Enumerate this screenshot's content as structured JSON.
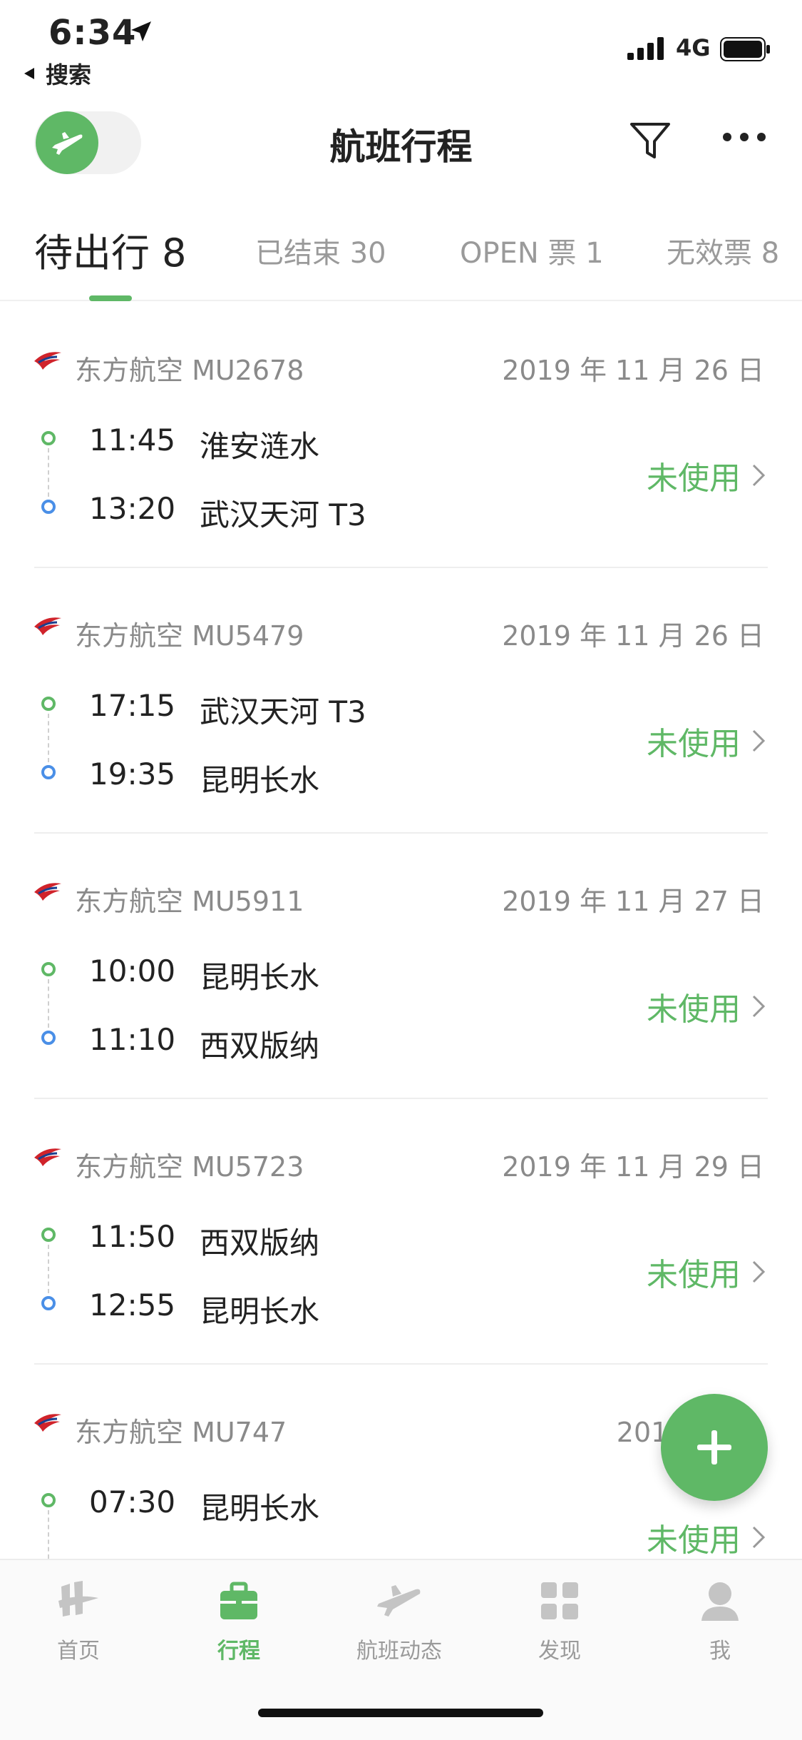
{
  "status_bar": {
    "time": "6:34",
    "back_label": "搜索",
    "network": "4G"
  },
  "nav": {
    "title": "航班行程"
  },
  "tabs": [
    {
      "label": "待出行 8",
      "active": true
    },
    {
      "label": "已结束 30",
      "active": false
    },
    {
      "label": "OPEN 票 1",
      "active": false
    },
    {
      "label": "无效票 8",
      "active": false
    }
  ],
  "flights": [
    {
      "airline": "东方航空 MU2678",
      "date": "2019 年 11 月 26 日",
      "dep_time": "11:45",
      "dep_place": "淮安涟水",
      "arr_time": "13:20",
      "arr_place": "武汉天河 T3",
      "status": "未使用"
    },
    {
      "airline": "东方航空 MU5479",
      "date": "2019 年 11 月 26 日",
      "dep_time": "17:15",
      "dep_place": "武汉天河 T3",
      "arr_time": "19:35",
      "arr_place": "昆明长水",
      "status": "未使用"
    },
    {
      "airline": "东方航空 MU5911",
      "date": "2019 年 11 月 27 日",
      "dep_time": "10:00",
      "dep_place": "昆明长水",
      "arr_time": "11:10",
      "arr_place": "西双版纳",
      "status": "未使用"
    },
    {
      "airline": "东方航空 MU5723",
      "date": "2019 年 11 月 29 日",
      "dep_time": "11:50",
      "dep_place": "西双版纳",
      "arr_time": "12:55",
      "arr_place": "昆明长水",
      "status": "未使用"
    },
    {
      "airline": "东方航空 MU747",
      "date": "2019 年 11",
      "dep_time": "07:30",
      "dep_place": "昆明长水",
      "arr_time": "",
      "arr_place": "",
      "status": "未使用"
    }
  ],
  "tabbar": [
    {
      "label": "首页",
      "icon": "home-icon",
      "active": false
    },
    {
      "label": "行程",
      "icon": "briefcase-icon",
      "active": true
    },
    {
      "label": "航班动态",
      "icon": "plane-icon",
      "active": false
    },
    {
      "label": "发现",
      "icon": "grid-icon",
      "active": false
    },
    {
      "label": "我",
      "icon": "user-icon",
      "active": false
    }
  ],
  "colors": {
    "accent": "#5fb866",
    "arrival_dot": "#4a8fe7",
    "secondary_text": "#8a8a8a"
  }
}
